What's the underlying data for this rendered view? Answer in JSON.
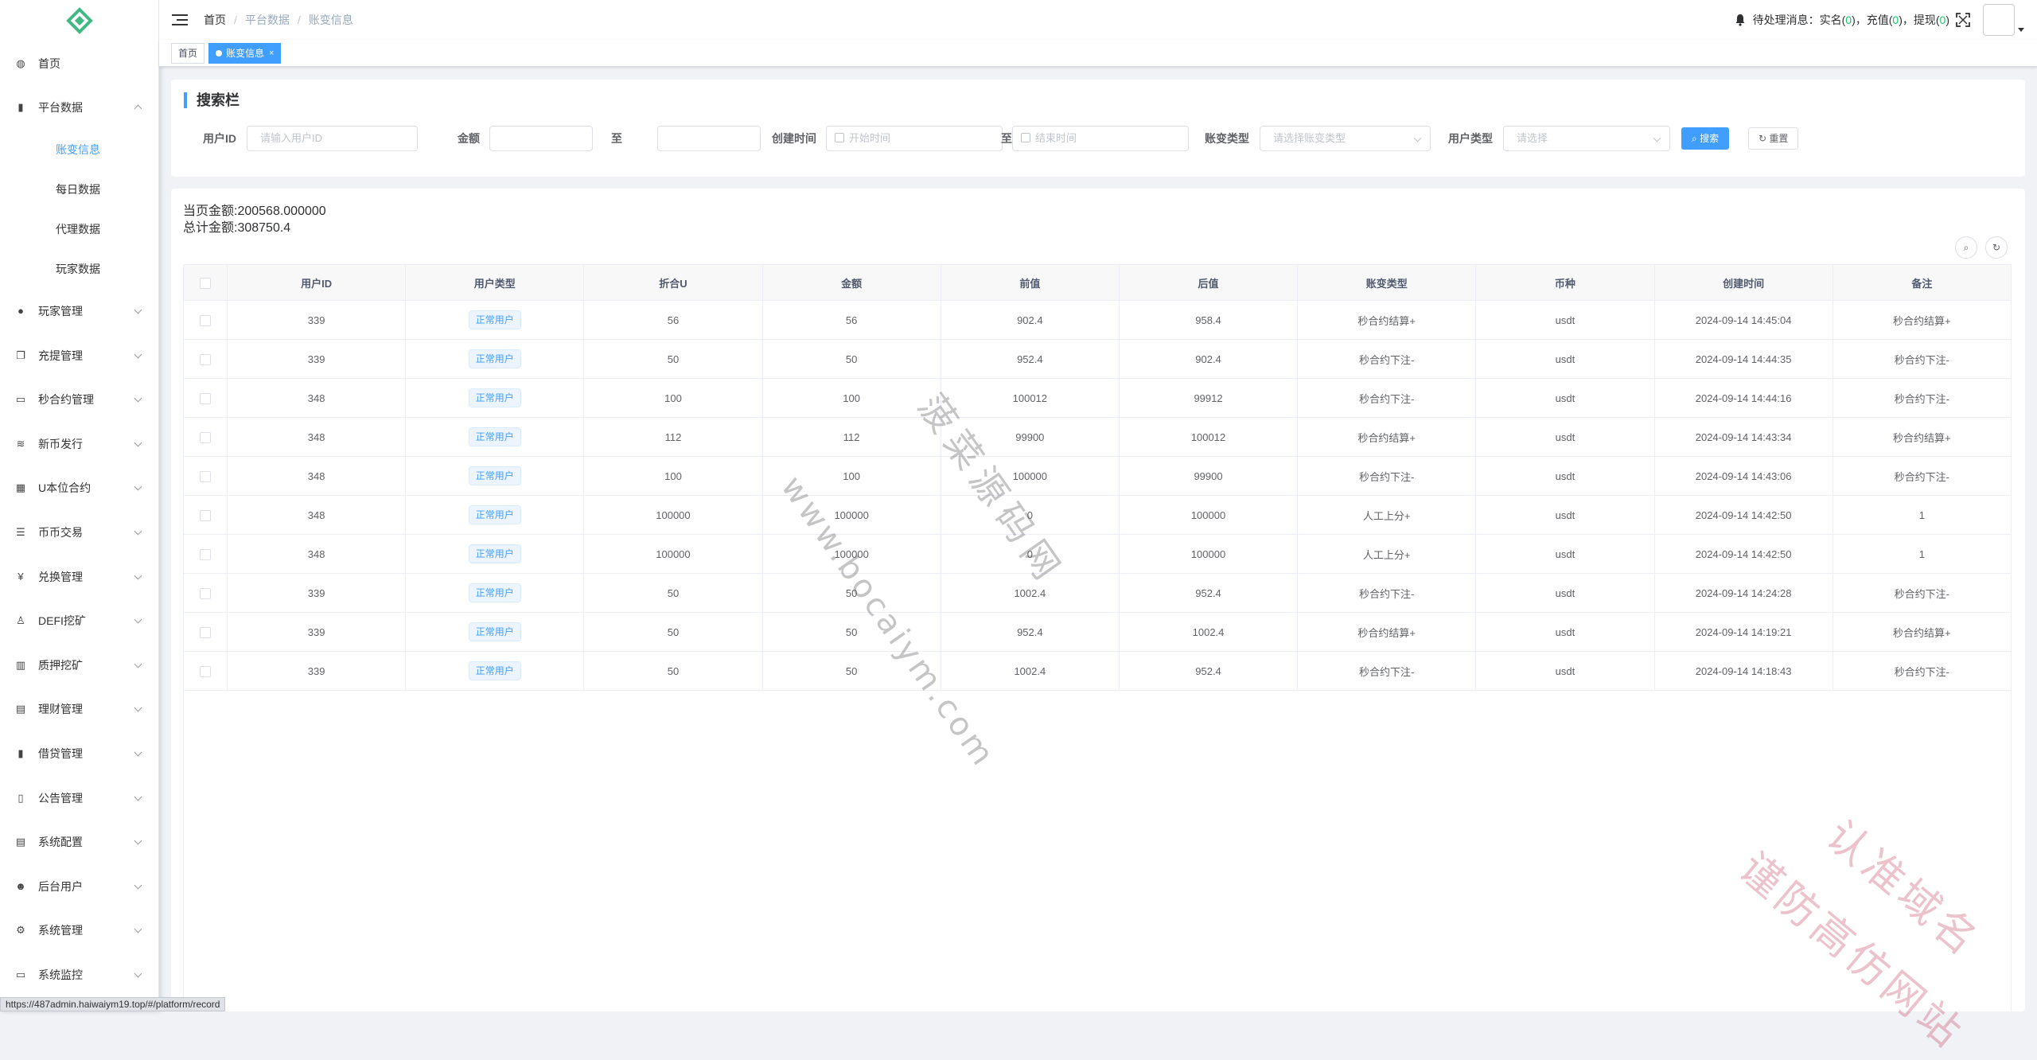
{
  "sidebar": {
    "items": [
      {
        "label": "首页",
        "icon": "dashboard-icon",
        "has_arrow": false
      },
      {
        "label": "平台数据",
        "icon": "data-icon",
        "has_arrow": true,
        "expanded": true,
        "children": [
          {
            "label": "账变信息",
            "active": true
          },
          {
            "label": "每日数据",
            "active": false
          },
          {
            "label": "代理数据",
            "active": false
          },
          {
            "label": "玩家数据",
            "active": false
          }
        ]
      },
      {
        "label": "玩家管理",
        "icon": "user-icon",
        "has_arrow": true
      },
      {
        "label": "充提管理",
        "icon": "copy-icon",
        "has_arrow": true
      },
      {
        "label": "秒合约管理",
        "icon": "monitor-icon",
        "has_arrow": true
      },
      {
        "label": "新币发行",
        "icon": "coin-icon",
        "has_arrow": true
      },
      {
        "label": "U本位合约",
        "icon": "grid-icon",
        "has_arrow": true
      },
      {
        "label": "币币交易",
        "icon": "list-icon",
        "has_arrow": true
      },
      {
        "label": "兑换管理",
        "icon": "yen-icon",
        "has_arrow": true
      },
      {
        "label": "DEFI挖矿",
        "icon": "tree-icon",
        "has_arrow": true
      },
      {
        "label": "质押挖矿",
        "icon": "bar-chart-icon",
        "has_arrow": true
      },
      {
        "label": "理财管理",
        "icon": "document-icon",
        "has_arrow": true
      },
      {
        "label": "借贷管理",
        "icon": "data-icon",
        "has_arrow": true
      },
      {
        "label": "公告管理",
        "icon": "book-icon",
        "has_arrow": true
      },
      {
        "label": "系统配置",
        "icon": "document-icon",
        "has_arrow": true
      },
      {
        "label": "后台用户",
        "icon": "peoples-icon",
        "has_arrow": true
      },
      {
        "label": "系统管理",
        "icon": "gear-icon",
        "has_arrow": true
      },
      {
        "label": "系统监控",
        "icon": "monitor-icon",
        "has_arrow": true
      }
    ]
  },
  "navbar": {
    "breadcrumb": [
      "首页",
      "平台数据",
      "账变信息"
    ],
    "pending_prefix": "待处理消息：实名(",
    "pending_realname": "0",
    "pending_mid1": ")，充值(",
    "pending_recharge": "0",
    "pending_mid2": ")，提现(",
    "pending_withdraw": "0",
    "pending_suffix": ")"
  },
  "tags": {
    "home": "首页",
    "active": "账变信息",
    "close": "×"
  },
  "search": {
    "title": "搜索栏",
    "user_id_label": "用户ID",
    "user_id_placeholder": "请输入用户ID",
    "amount_label": "金额",
    "to_label": "至",
    "created_label": "创建时间",
    "start_placeholder": "开始时间",
    "to_label2": "至",
    "end_placeholder": "结束时间",
    "change_type_label": "账变类型",
    "change_type_placeholder": "请选择账变类型",
    "user_type_label": "用户类型",
    "user_type_placeholder": "请选择",
    "search_button": "搜索",
    "reset_button": "重置"
  },
  "summary": {
    "page_amount": "当页金额:200568.000000",
    "total_amount": "总计金额:308750.4"
  },
  "table": {
    "columns": [
      "用户ID",
      "用户类型",
      "折合U",
      "金额",
      "前值",
      "后值",
      "账变类型",
      "币种",
      "创建时间",
      "备注"
    ],
    "rows": [
      {
        "uid": "339",
        "utype": "正常用户",
        "u": "56",
        "amount": "56",
        "before": "902.4",
        "after": "958.4",
        "ctype": "秒合约结算+",
        "coin": "usdt",
        "time": "2024-09-14 14:45:04",
        "remark": "秒合约结算+"
      },
      {
        "uid": "339",
        "utype": "正常用户",
        "u": "50",
        "amount": "50",
        "before": "952.4",
        "after": "902.4",
        "ctype": "秒合约下注-",
        "coin": "usdt",
        "time": "2024-09-14 14:44:35",
        "remark": "秒合约下注-"
      },
      {
        "uid": "348",
        "utype": "正常用户",
        "u": "100",
        "amount": "100",
        "before": "100012",
        "after": "99912",
        "ctype": "秒合约下注-",
        "coin": "usdt",
        "time": "2024-09-14 14:44:16",
        "remark": "秒合约下注-"
      },
      {
        "uid": "348",
        "utype": "正常用户",
        "u": "112",
        "amount": "112",
        "before": "99900",
        "after": "100012",
        "ctype": "秒合约结算+",
        "coin": "usdt",
        "time": "2024-09-14 14:43:34",
        "remark": "秒合约结算+"
      },
      {
        "uid": "348",
        "utype": "正常用户",
        "u": "100",
        "amount": "100",
        "before": "100000",
        "after": "99900",
        "ctype": "秒合约下注-",
        "coin": "usdt",
        "time": "2024-09-14 14:43:06",
        "remark": "秒合约下注-"
      },
      {
        "uid": "348",
        "utype": "正常用户",
        "u": "100000",
        "amount": "100000",
        "before": "0",
        "after": "100000",
        "ctype": "人工上分+",
        "coin": "usdt",
        "time": "2024-09-14 14:42:50",
        "remark": "1"
      },
      {
        "uid": "348",
        "utype": "正常用户",
        "u": "100000",
        "amount": "100000",
        "before": "0",
        "after": "100000",
        "ctype": "人工上分+",
        "coin": "usdt",
        "time": "2024-09-14 14:42:50",
        "remark": "1"
      },
      {
        "uid": "339",
        "utype": "正常用户",
        "u": "50",
        "amount": "50",
        "before": "1002.4",
        "after": "952.4",
        "ctype": "秒合约下注-",
        "coin": "usdt",
        "time": "2024-09-14 14:24:28",
        "remark": "秒合约下注-"
      },
      {
        "uid": "339",
        "utype": "正常用户",
        "u": "50",
        "amount": "50",
        "before": "952.4",
        "after": "1002.4",
        "ctype": "秒合约结算+",
        "coin": "usdt",
        "time": "2024-09-14 14:19:21",
        "remark": "秒合约结算+"
      },
      {
        "uid": "339",
        "utype": "正常用户",
        "u": "50",
        "amount": "50",
        "before": "1002.4",
        "after": "952.4",
        "ctype": "秒合约下注-",
        "coin": "usdt",
        "time": "2024-09-14 14:18:43",
        "remark": "秒合约下注-"
      }
    ]
  },
  "statusbar": {
    "url": "https://487admin.haiwaiym19.top/#/platform/record"
  },
  "watermarks": {
    "center_url": "www.bocaiym.com",
    "center_cn": "菠菜源码网",
    "corner_line1": "认准域名",
    "corner_line2": "谨防高仿网站"
  },
  "colors": {
    "primary": "#409eff",
    "success": "#13ce66",
    "logo": "#42b983"
  }
}
